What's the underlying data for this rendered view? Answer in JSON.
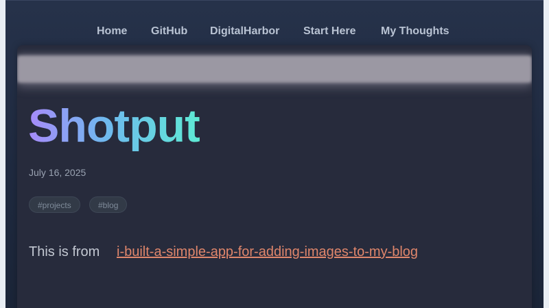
{
  "nav": {
    "items": [
      {
        "label": "Home"
      },
      {
        "label": "GitHub"
      },
      {
        "label": "DigitalHarbor"
      },
      {
        "label": "Start Here"
      },
      {
        "label": "My Thoughts"
      }
    ]
  },
  "post": {
    "title": "Shotput",
    "date": "July 16, 2025",
    "tags": [
      "#projects",
      "#blog"
    ],
    "body_prefix": "This is from",
    "link_text": "i-built-a-simple-app-for-adding-images-to-my-blog"
  },
  "colors": {
    "accent_link": "#e0866b",
    "title_gradient_start": "#a78bfa",
    "title_gradient_end": "#5eead4"
  }
}
